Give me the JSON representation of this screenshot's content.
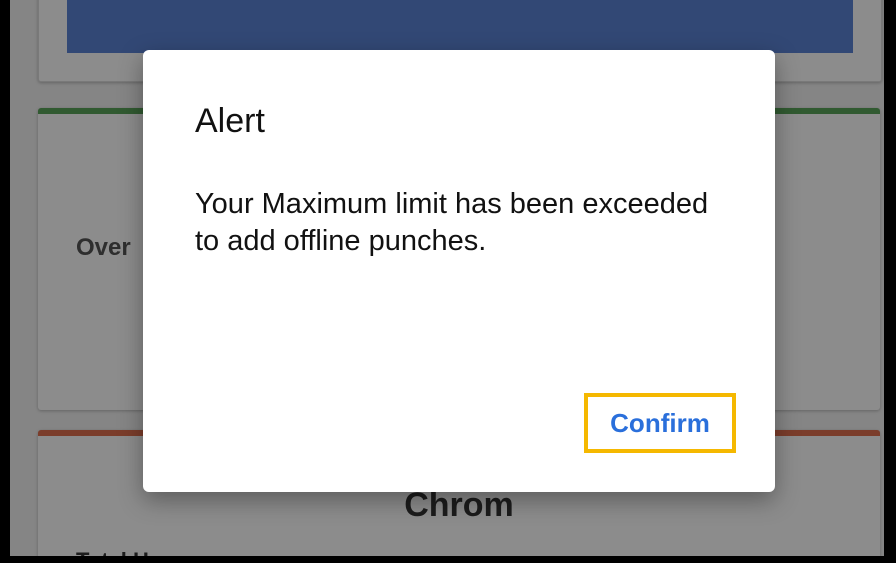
{
  "background": {
    "card_mid_label": "Over",
    "card_bot_title": "Chrom",
    "card_bot_subtitle": "Total H",
    "colors": {
      "blue_band": "#5b84d6",
      "green_accent": "#5aa45a",
      "red_accent": "#e0704f"
    }
  },
  "dialog": {
    "title": "Alert",
    "message": "Your Maximum limit has been exceeded to add offline punches.",
    "confirm_label": "Confirm",
    "colors": {
      "confirm_text": "#2a6fdb",
      "highlight_border": "#f5b800"
    }
  }
}
